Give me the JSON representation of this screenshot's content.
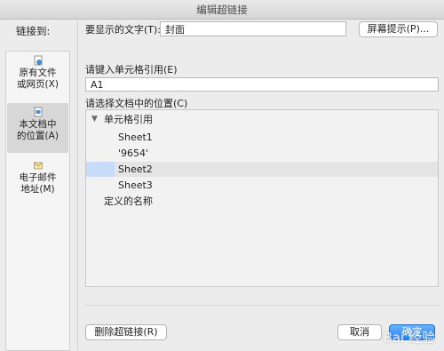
{
  "window": {
    "title": "编辑超链接"
  },
  "sidebar": {
    "title": "链接到:",
    "items": [
      {
        "label": "原有文件\n或网页(X)",
        "icon": "document-globe-icon",
        "selected": false
      },
      {
        "label": "本文档中\n的位置(A)",
        "icon": "document-location-icon",
        "selected": true
      },
      {
        "label": "电子邮件\n地址(M)",
        "icon": "envelope-icon",
        "selected": false
      }
    ]
  },
  "main": {
    "display_text_label": "要显示的文字(T):",
    "display_text_value": "封面",
    "screen_tip_button": "屏幕提示(P)...",
    "cell_ref_label": "请键入单元格引用(E)",
    "cell_ref_value": "A1",
    "location_label": "请选择文档中的位置(C)",
    "tree": {
      "group_label": "单元格引用",
      "sheets": [
        "Sheet1",
        "'9654'",
        "Sheet2",
        "Sheet3"
      ],
      "selected_sheet": "Sheet2",
      "defined_names_label": "定义的名称"
    },
    "remove_link_button": "删除超链接(R)",
    "cancel_button": "取消",
    "ok_button": "确定"
  },
  "watermark": {
    "text": "Bai 经验"
  },
  "colors": {
    "primary_button": "#1a82fb",
    "selection": "#c6dcf8"
  }
}
